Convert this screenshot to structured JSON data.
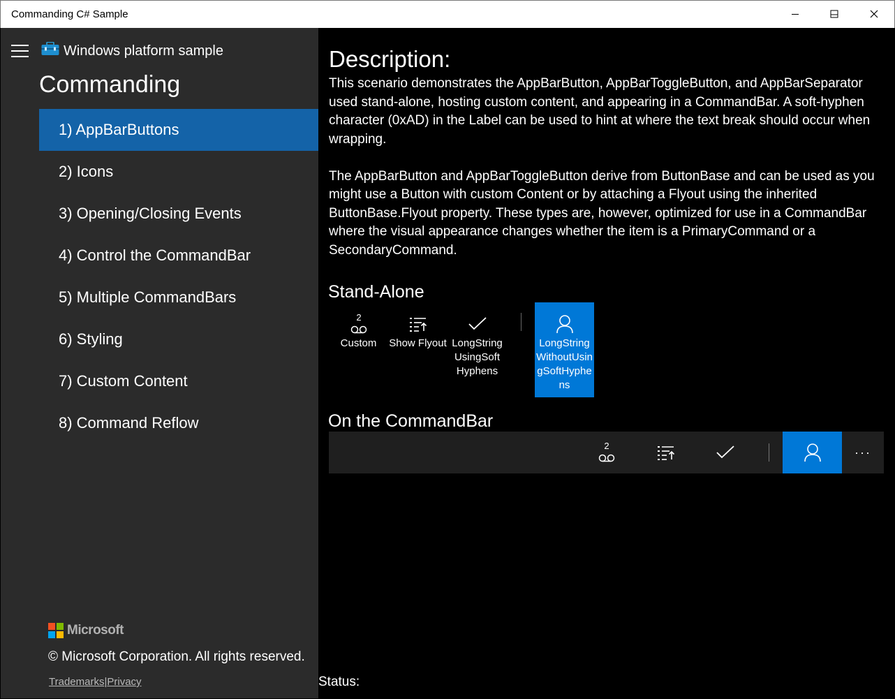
{
  "window": {
    "title": "Commanding C# Sample",
    "controls": [
      "minimize-icon",
      "maximize-icon",
      "close-icon"
    ]
  },
  "sidebar": {
    "brand": "Windows platform sample",
    "section_title": "Commanding",
    "items": [
      {
        "label": "1) AppBarButtons",
        "selected": true
      },
      {
        "label": "2) Icons"
      },
      {
        "label": "3) Opening/Closing Events"
      },
      {
        "label": "4) Control the CommandBar"
      },
      {
        "label": "5) Multiple CommandBars"
      },
      {
        "label": "6) Styling"
      },
      {
        "label": "7) Custom Content"
      },
      {
        "label": "8) Command Reflow"
      }
    ],
    "footer": {
      "logo_text": "Microsoft",
      "logo_colors": [
        "#f25022",
        "#7fba00",
        "#00a4ef",
        "#ffb900"
      ],
      "copyright": "© Microsoft Corporation. All rights reserved.",
      "trademarks": "Trademarks",
      "divider": "|",
      "privacy": "Privacy"
    }
  },
  "main": {
    "description_heading": "Description:",
    "description_p1": "This scenario demonstrates the AppBarButton, AppBarToggleButton, and AppBarSeparator used stand-alone, hosting custom content, and appearing in a CommandBar. A soft-hyphen character (0xAD) in the Label can be used to hint at where the text break should occur when wrapping.",
    "description_p2": "The AppBarButton and AppBarToggleButton derive from ButtonBase and can be used as you might use a Button with custom Content or by attaching a Flyout using the inherited ButtonBase.Flyout property. These types are, however, optimized for use in a CommandBar where the visual appearance changes whether the item is a PrimaryCommand or a SecondaryCommand.",
    "standalone_heading": "Stand-Alone",
    "standalone_buttons": {
      "custom": {
        "label": "Custom",
        "badge": "2",
        "icon": "voicemail-icon"
      },
      "flyout": {
        "label": "Show Flyout",
        "icon": "list-sort-icon"
      },
      "softhyphen": {
        "label": "LongString UsingSoft Hyphens",
        "icon": "checkmark-icon"
      },
      "nosofthyphen": {
        "label": "LongStringWithoutUsingSoftHyphens",
        "icon": "contact-icon",
        "checked": true
      }
    },
    "commandbar_heading": "On the CommandBar",
    "commandbar": {
      "badge": "2",
      "more": "···"
    },
    "accent": "#0078d7"
  },
  "status": {
    "label": "Status:"
  }
}
